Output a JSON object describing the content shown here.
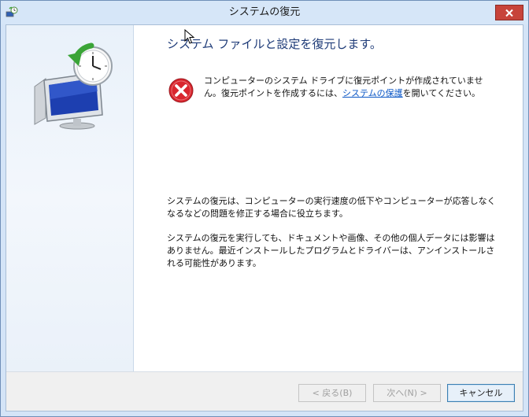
{
  "window": {
    "title": "システムの復元"
  },
  "content": {
    "heading": "システム ファイルと設定を復元します。",
    "error_text_before": "コンピューターのシステム ドライブに復元ポイントが作成されていません。復元ポイントを作成するには、",
    "error_link": "システムの保護",
    "error_text_after": "を開いてください。",
    "info1": "システムの復元は、コンピューターの実行速度の低下やコンピューターが応答しなくなるなどの問題を修正する場合に役立ちます。",
    "info2": "システムの復元を実行しても、ドキュメントや画像、その他の個人データには影響はありません。最近インストールしたプログラムとドライバーは、アンインストールされる可能性があります。"
  },
  "buttons": {
    "back": "< 戻る(B)",
    "next": "次へ(N) >",
    "cancel": "キャンセル"
  },
  "icons": {
    "app": "system-restore-icon",
    "hero": "system-restore-monitor-icon",
    "error": "error-icon",
    "close": "close-icon"
  },
  "colors": {
    "link": "#0b57c6",
    "heading": "#1e3b78",
    "close_button": "#c7433a"
  }
}
